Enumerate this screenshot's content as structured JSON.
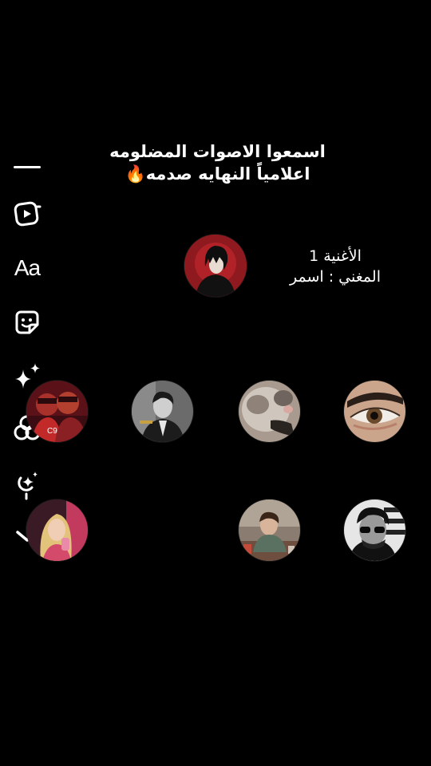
{
  "title": {
    "line1": "اسمعوا الاصوات المضلومه",
    "line2": "اعلامياً النهايه صدمه🔥"
  },
  "toolbar": {
    "items": [
      {
        "name": "collapse-line-icon"
      },
      {
        "name": "clip-play-icon"
      },
      {
        "name": "text-tool",
        "label": "Aa"
      },
      {
        "name": "sticker-icon"
      },
      {
        "name": "sparkle-effects-icon"
      },
      {
        "name": "color-circles-icon"
      },
      {
        "name": "mic-sparkle-icon"
      },
      {
        "name": "chevron-down-icon"
      }
    ]
  },
  "song": {
    "title": "الأغنية 1",
    "singer": "المغني : اسمر"
  },
  "colors": {
    "background": "#000000",
    "text": "#ffffff",
    "featured_avatar_bg": "#9b1c22"
  }
}
